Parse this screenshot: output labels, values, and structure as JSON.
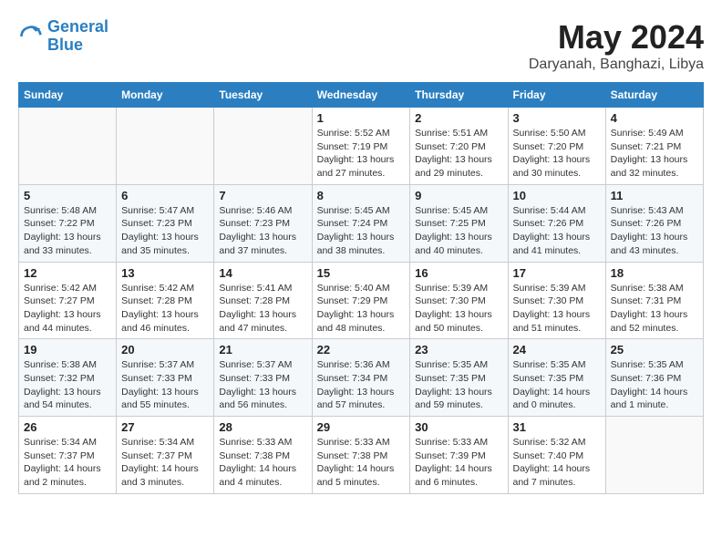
{
  "header": {
    "logo_line1": "General",
    "logo_line2": "Blue",
    "month": "May 2024",
    "location": "Daryanah, Banghazi, Libya"
  },
  "weekdays": [
    "Sunday",
    "Monday",
    "Tuesday",
    "Wednesday",
    "Thursday",
    "Friday",
    "Saturday"
  ],
  "weeks": [
    [
      {
        "day": "",
        "info": ""
      },
      {
        "day": "",
        "info": ""
      },
      {
        "day": "",
        "info": ""
      },
      {
        "day": "1",
        "info": "Sunrise: 5:52 AM\nSunset: 7:19 PM\nDaylight: 13 hours and 27 minutes."
      },
      {
        "day": "2",
        "info": "Sunrise: 5:51 AM\nSunset: 7:20 PM\nDaylight: 13 hours and 29 minutes."
      },
      {
        "day": "3",
        "info": "Sunrise: 5:50 AM\nSunset: 7:20 PM\nDaylight: 13 hours and 30 minutes."
      },
      {
        "day": "4",
        "info": "Sunrise: 5:49 AM\nSunset: 7:21 PM\nDaylight: 13 hours and 32 minutes."
      }
    ],
    [
      {
        "day": "5",
        "info": "Sunrise: 5:48 AM\nSunset: 7:22 PM\nDaylight: 13 hours and 33 minutes."
      },
      {
        "day": "6",
        "info": "Sunrise: 5:47 AM\nSunset: 7:23 PM\nDaylight: 13 hours and 35 minutes."
      },
      {
        "day": "7",
        "info": "Sunrise: 5:46 AM\nSunset: 7:23 PM\nDaylight: 13 hours and 37 minutes."
      },
      {
        "day": "8",
        "info": "Sunrise: 5:45 AM\nSunset: 7:24 PM\nDaylight: 13 hours and 38 minutes."
      },
      {
        "day": "9",
        "info": "Sunrise: 5:45 AM\nSunset: 7:25 PM\nDaylight: 13 hours and 40 minutes."
      },
      {
        "day": "10",
        "info": "Sunrise: 5:44 AM\nSunset: 7:26 PM\nDaylight: 13 hours and 41 minutes."
      },
      {
        "day": "11",
        "info": "Sunrise: 5:43 AM\nSunset: 7:26 PM\nDaylight: 13 hours and 43 minutes."
      }
    ],
    [
      {
        "day": "12",
        "info": "Sunrise: 5:42 AM\nSunset: 7:27 PM\nDaylight: 13 hours and 44 minutes."
      },
      {
        "day": "13",
        "info": "Sunrise: 5:42 AM\nSunset: 7:28 PM\nDaylight: 13 hours and 46 minutes."
      },
      {
        "day": "14",
        "info": "Sunrise: 5:41 AM\nSunset: 7:28 PM\nDaylight: 13 hours and 47 minutes."
      },
      {
        "day": "15",
        "info": "Sunrise: 5:40 AM\nSunset: 7:29 PM\nDaylight: 13 hours and 48 minutes."
      },
      {
        "day": "16",
        "info": "Sunrise: 5:39 AM\nSunset: 7:30 PM\nDaylight: 13 hours and 50 minutes."
      },
      {
        "day": "17",
        "info": "Sunrise: 5:39 AM\nSunset: 7:30 PM\nDaylight: 13 hours and 51 minutes."
      },
      {
        "day": "18",
        "info": "Sunrise: 5:38 AM\nSunset: 7:31 PM\nDaylight: 13 hours and 52 minutes."
      }
    ],
    [
      {
        "day": "19",
        "info": "Sunrise: 5:38 AM\nSunset: 7:32 PM\nDaylight: 13 hours and 54 minutes."
      },
      {
        "day": "20",
        "info": "Sunrise: 5:37 AM\nSunset: 7:33 PM\nDaylight: 13 hours and 55 minutes."
      },
      {
        "day": "21",
        "info": "Sunrise: 5:37 AM\nSunset: 7:33 PM\nDaylight: 13 hours and 56 minutes."
      },
      {
        "day": "22",
        "info": "Sunrise: 5:36 AM\nSunset: 7:34 PM\nDaylight: 13 hours and 57 minutes."
      },
      {
        "day": "23",
        "info": "Sunrise: 5:35 AM\nSunset: 7:35 PM\nDaylight: 13 hours and 59 minutes."
      },
      {
        "day": "24",
        "info": "Sunrise: 5:35 AM\nSunset: 7:35 PM\nDaylight: 14 hours and 0 minutes."
      },
      {
        "day": "25",
        "info": "Sunrise: 5:35 AM\nSunset: 7:36 PM\nDaylight: 14 hours and 1 minute."
      }
    ],
    [
      {
        "day": "26",
        "info": "Sunrise: 5:34 AM\nSunset: 7:37 PM\nDaylight: 14 hours and 2 minutes."
      },
      {
        "day": "27",
        "info": "Sunrise: 5:34 AM\nSunset: 7:37 PM\nDaylight: 14 hours and 3 minutes."
      },
      {
        "day": "28",
        "info": "Sunrise: 5:33 AM\nSunset: 7:38 PM\nDaylight: 14 hours and 4 minutes."
      },
      {
        "day": "29",
        "info": "Sunrise: 5:33 AM\nSunset: 7:38 PM\nDaylight: 14 hours and 5 minutes."
      },
      {
        "day": "30",
        "info": "Sunrise: 5:33 AM\nSunset: 7:39 PM\nDaylight: 14 hours and 6 minutes."
      },
      {
        "day": "31",
        "info": "Sunrise: 5:32 AM\nSunset: 7:40 PM\nDaylight: 14 hours and 7 minutes."
      },
      {
        "day": "",
        "info": ""
      }
    ]
  ]
}
